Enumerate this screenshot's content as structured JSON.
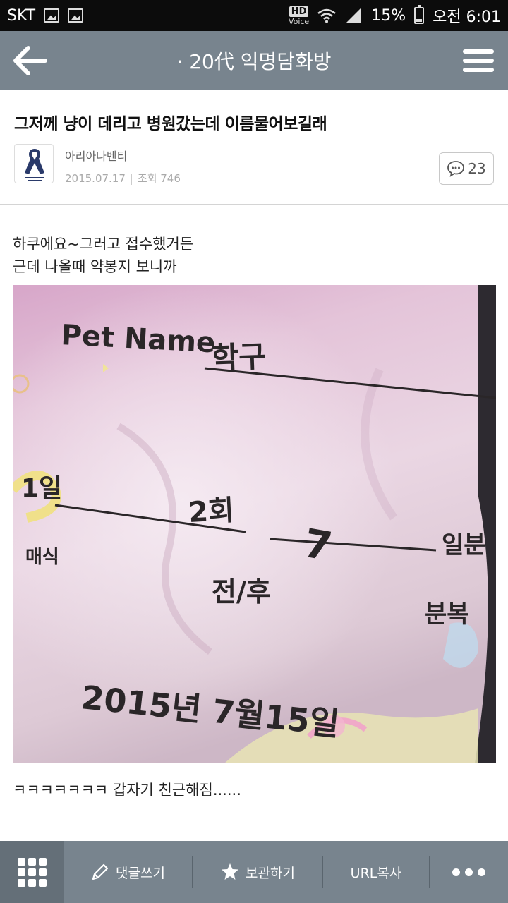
{
  "status_bar": {
    "carrier": "SKT",
    "hd_label": "HD",
    "voice_label": "Voice",
    "battery": "15%",
    "time": "오전 6:01"
  },
  "app_bar": {
    "title": "· 20代 익명담화방"
  },
  "post": {
    "title": "그저께 냥이 데리고 병원갔는데 이름물어보길래",
    "author": "아리아나벤티",
    "date": "2015.07.17",
    "views": "조회 746",
    "comment_count": "23",
    "body_line1": "하쿠에요~그러고 접수했거든",
    "body_line2": "근데 나올때 약봉지 보니까",
    "footer": "ㅋㅋㅋㅋㅋㅋㅋ 갑자기 친근해짐......"
  },
  "photo": {
    "pet_name_label": "Pet Name",
    "pet_name_value": "학구",
    "day_label": "1일",
    "times": "2회",
    "interval": "7",
    "daily_label": "일분",
    "meal_label": "매식",
    "before_after": "전/후",
    "divided_label": "분복",
    "date_written": "2015년 7월15일"
  },
  "toolbar": {
    "write_comment": "댓글쓰기",
    "save": "보관하기",
    "copy_url": "URL복사"
  },
  "colors": {
    "bar": "#78848e",
    "bar_dark": "#646f78",
    "photo_bg": "#d9b7cf"
  }
}
